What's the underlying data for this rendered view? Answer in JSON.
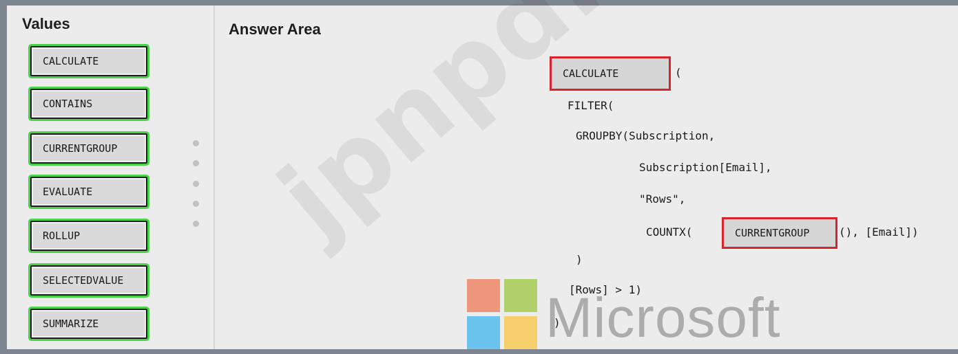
{
  "values_panel": {
    "title": "Values",
    "items": [
      "CALCULATE",
      "CONTAINS",
      "CURRENTGROUP",
      "EVALUATE",
      "ROLLUP",
      "SELECTEDVALUE",
      "SUMMARIZE"
    ]
  },
  "answer_area": {
    "title": "Answer Area",
    "slot1_value": "CALCULATE",
    "line1_suffix": "(",
    "line2": "FILTER(",
    "line3": "GROUPBY(Subscription,",
    "line4": "Subscription[Email],",
    "line5": "\"Rows\",",
    "line6_prefix": "COUNTX(",
    "slot2_value": "CURRENTGROUP",
    "line6_suffix": "(), [Email])",
    "line7": ")",
    "line8": "[Rows] > 1)",
    "line9": ")"
  },
  "watermark": "jpnpdf.com",
  "brand": {
    "name": "Microsoft",
    "colors": {
      "red": "#f25022",
      "green": "#7fba00",
      "blue": "#00a4ef",
      "yellow": "#ffb900",
      "drop_border": "#d8232a",
      "chip_glow": "#49d24a"
    }
  }
}
